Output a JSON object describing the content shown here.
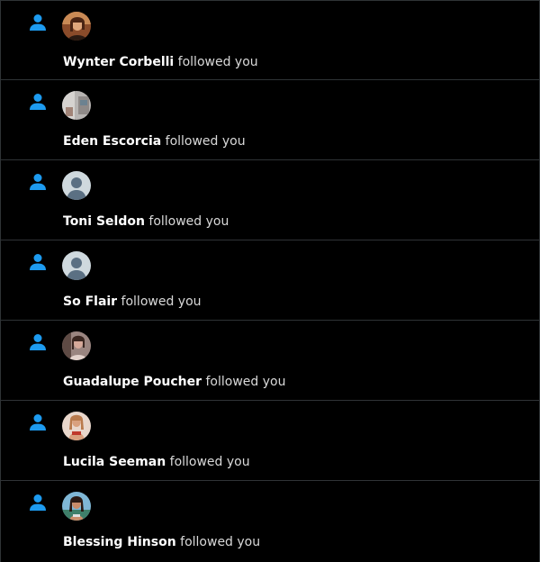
{
  "colors": {
    "accent": "#1d9bf0",
    "background": "#000000",
    "divider": "#2f3336"
  },
  "notifications": [
    {
      "icon": "person-icon",
      "avatar": "photo",
      "name": "Wynter Corbelli",
      "action": "followed you"
    },
    {
      "icon": "person-icon",
      "avatar": "photo",
      "name": "Eden Escorcia",
      "action": "followed you"
    },
    {
      "icon": "person-icon",
      "avatar": "default-avatar",
      "name": "Toni Seldon",
      "action": "followed you"
    },
    {
      "icon": "person-icon",
      "avatar": "default-avatar",
      "name": "So Flair",
      "action": "followed you"
    },
    {
      "icon": "person-icon",
      "avatar": "photo",
      "name": "Guadalupe Poucher",
      "action": "followed you"
    },
    {
      "icon": "person-icon",
      "avatar": "photo",
      "name": "Lucila Seeman",
      "action": "followed you"
    },
    {
      "icon": "person-icon",
      "avatar": "photo",
      "name": "Blessing Hinson",
      "action": "followed you"
    }
  ]
}
